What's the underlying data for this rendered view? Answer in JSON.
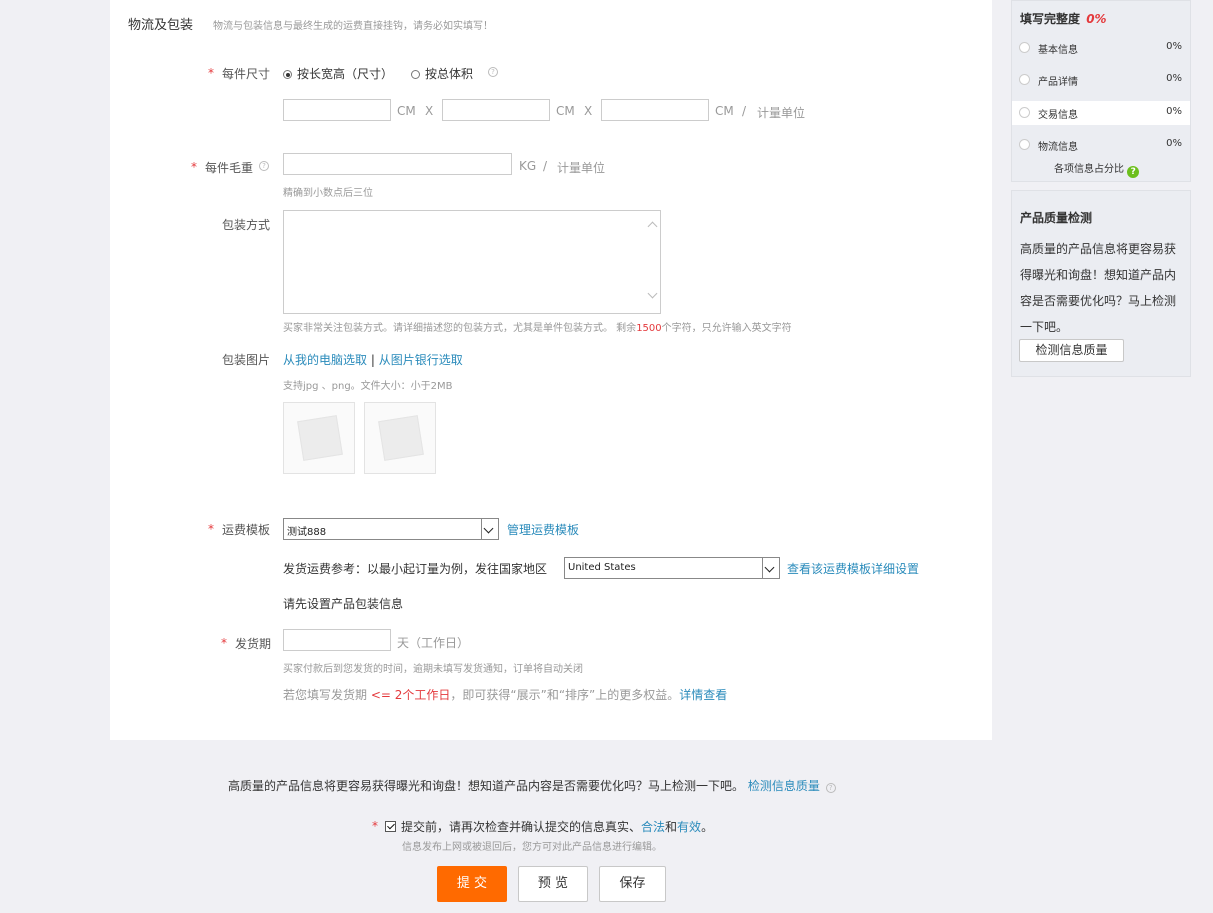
{
  "section": {
    "title": "物流及包装",
    "desc": "物流与包装信息与最终生成的运费直接挂钩，请务必如实填写！"
  },
  "size": {
    "label": "每件尺寸",
    "opt_lwh": "按长宽高（尺寸）",
    "opt_volume": "按总体积",
    "unit_cm": "CM",
    "x": "X",
    "slash": "/",
    "measure_unit": "计量单位"
  },
  "weight": {
    "label": "每件毛重",
    "unit": "KG",
    "slash": "/",
    "measure_unit": "计量单位",
    "hint": "精确到小数点后三位"
  },
  "packaging": {
    "label": "包装方式",
    "hint_pre": "买家非常关注包装方式。请详细描述您的包装方式，尤其是单件包装方式。 剩余",
    "remaining": "1500",
    "hint_post": "个字符，只允许输入英文字符"
  },
  "package_image": {
    "label": "包装图片",
    "from_pc": "从我的电脑选取",
    "separator": "|",
    "from_bank": "从图片银行选取",
    "hint": "支持jpg 、png。文件大小：小于2MB"
  },
  "shipping": {
    "label": "运费模板",
    "selected": "测试888",
    "manage": "管理运费模板",
    "reference": "发货运费参考：以最小起订量为例，发往国家地区",
    "country": "United States",
    "view_detail": "查看该运费模板详细设置",
    "notice": "请先设置产品包装信息"
  },
  "delivery": {
    "label": "发货期",
    "unit": "天（工作日）",
    "hint": "买家付款后到您发货的时间，逾期未填写发货通知，订单将自动关闭",
    "benefit_pre": "若您填写发货期",
    "benefit_hl": "<= 2个工作日",
    "benefit_mid": "，即可获得“展示”和“排序”上的更多权益。",
    "benefit_link": "详情查看"
  },
  "completeness": {
    "title": "填写完整度",
    "percent": "0%",
    "items": [
      {
        "name": "基本信息",
        "pct": "0%"
      },
      {
        "name": "产品详情",
        "pct": "0%"
      },
      {
        "name": "交易信息",
        "pct": "0%"
      },
      {
        "name": "物流信息",
        "pct": "0%"
      }
    ],
    "ratio_label": "各项信息占分比"
  },
  "quality": {
    "title": "产品质量检测",
    "text": "高质量的产品信息将更容易获得曝光和询盘！想知道产品内容是否需要优化吗？马上检测一下吧。",
    "button": "检测信息质量"
  },
  "footer": {
    "promo": "高质量的产品信息将更容易获得曝光和询盘！想知道产品内容是否需要优化吗？马上检测一下吧。",
    "promo_link": "检测信息质量",
    "confirm_pre": "提交前，请再次检查并确认提交的信息真实、",
    "confirm_link1": "合法",
    "confirm_and": "和",
    "confirm_link2": "有效",
    "confirm_end": "。",
    "confirm_hint": "信息发布上网或被退回后，您方可对此产品信息进行编辑。",
    "submit": "提 交",
    "preview": "预 览",
    "save": "保存"
  },
  "colors": {
    "accent": "#ff6a00",
    "link": "#2a8bbb",
    "required": "#e4393c",
    "completeness_pct": "#e4393c",
    "help_green": "#6cbf1c"
  }
}
